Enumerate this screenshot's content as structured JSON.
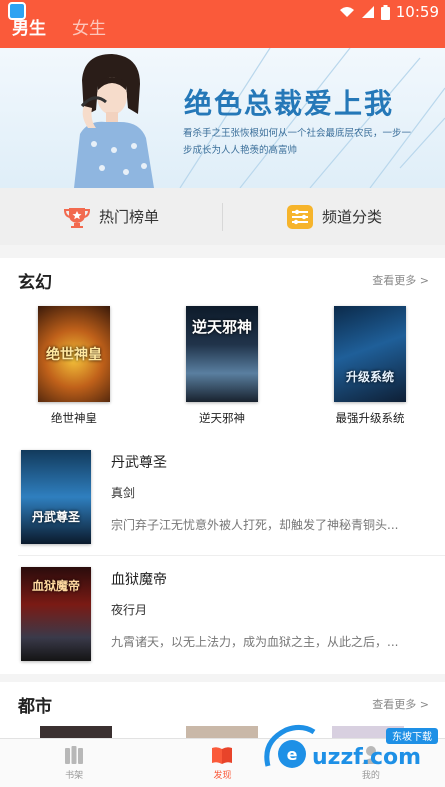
{
  "status_bar": {
    "time": "10:59"
  },
  "header": {
    "tabs": [
      {
        "label": "男生",
        "active": true
      },
      {
        "label": "女生",
        "active": false
      }
    ]
  },
  "banner": {
    "title": "绝色总裁爱上我",
    "description": "看杀手之王张恢根如何从一个社会最底层农民，一步一步成长为人人艳羡的高富帅",
    "page_count": 2,
    "active_page": 1
  },
  "quick_entries": [
    {
      "label": "热门榜单",
      "icon": "trophy-icon"
    },
    {
      "label": "频道分类",
      "icon": "sliders-icon"
    }
  ],
  "sections": [
    {
      "title": "玄幻",
      "more_label": "查看更多 >",
      "grid_books": [
        {
          "name": "绝世神皇",
          "cover_text": "绝世神皇"
        },
        {
          "name": "逆天邪神",
          "cover_text": "逆天邪神"
        },
        {
          "name": "最强升级系统",
          "cover_text": "升级系统"
        }
      ],
      "list_books": [
        {
          "title": "丹武尊圣",
          "author": "真剑",
          "description": "宗门弃子江无忧意外被人打死，却触发了神秘青铜头...",
          "cover_text": "丹武尊圣"
        },
        {
          "title": "血狱魔帝",
          "author": "夜行月",
          "description": "九霄诸天，以无上法力，成为血狱之主，从此之后，...",
          "cover_text": "血狱魔帝"
        }
      ]
    },
    {
      "title": "都市",
      "more_label": "查看更多 >"
    }
  ],
  "bottom_nav": [
    {
      "label": "书架",
      "icon": "bookshelf-icon",
      "active": false
    },
    {
      "label": "发现",
      "icon": "open-book-icon",
      "active": true
    },
    {
      "label": "我的",
      "icon": "profile-icon",
      "active": false
    }
  ],
  "watermark": {
    "brand": "uzzf.com",
    "tag": "东坡下载"
  },
  "colors": {
    "accent": "#fa5a3a",
    "banner_title": "#2578b8"
  }
}
